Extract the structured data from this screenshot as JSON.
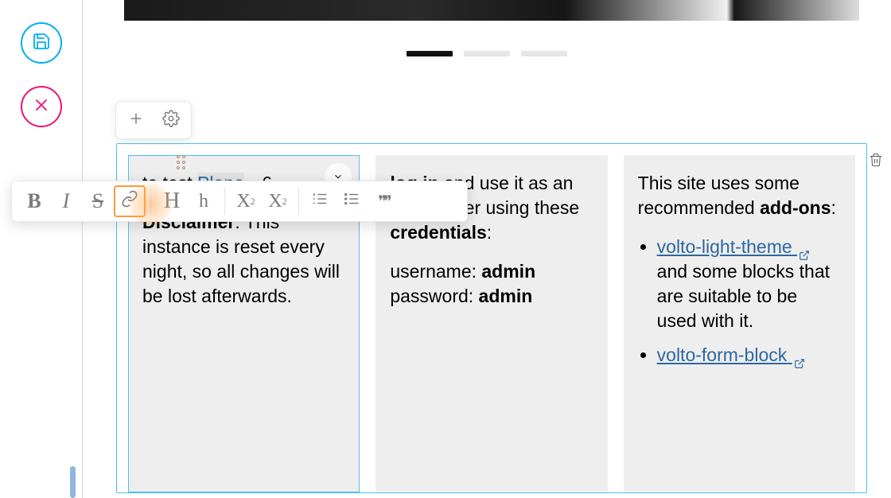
{
  "rail": {
    "save_label": "Save",
    "cancel_label": "Cancel"
  },
  "block_toolbar": {
    "add": "Add block",
    "settings": "Block settings"
  },
  "text_toolbar": {
    "bold": "B",
    "italic": "I",
    "strike": "S",
    "link": "§",
    "h1": "H",
    "h2": "h",
    "sub_base": "X",
    "sub_sub": "2",
    "sup_base": "X",
    "sup_sup": "2",
    "ol": "Ordered list",
    "ul": "Unordered list",
    "quote": "❞❞"
  },
  "pager": {
    "current": 1,
    "total": 3
  },
  "columns": {
    "col1": {
      "intro_suffix": "to test ",
      "link_text": "Plone",
      "intro_after": " 6.",
      "disclaimer_label": "Disclaimer",
      "disclaimer_text": ": This instance is reset every night, so all changes will be lost afterwards."
    },
    "col2": {
      "a": "log in",
      "b": " and use it as an admin user using these ",
      "c": "credentials",
      "d": ":",
      "user_label": "username: ",
      "user_value": "admin",
      "pass_label": "password: ",
      "pass_value": "admin"
    },
    "col3": {
      "intro_a": "This site uses some recommended ",
      "intro_b": "add-ons",
      "intro_c": ":",
      "item1_link": "volto-light-theme",
      "item1_rest": " and some blocks that are suitable to be used with it.",
      "item2_link": "volto-form-block"
    }
  }
}
